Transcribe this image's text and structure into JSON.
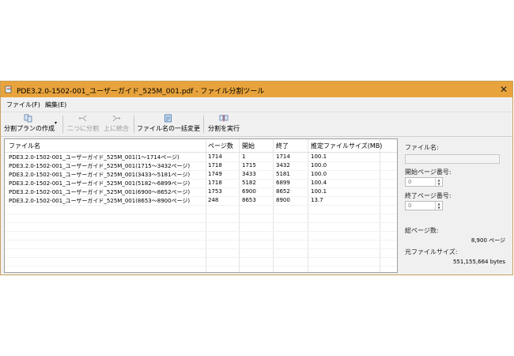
{
  "window": {
    "title": "PDE3.2.0-1502-001_ユーザーガイド_525M_001.pdf - ファイル分割ツール",
    "close_glyph": "✕"
  },
  "menu": {
    "items": [
      {
        "label": "ファイル(F)"
      },
      {
        "label": "編集(E)"
      }
    ]
  },
  "toolbar": {
    "split_plan_label": "分割プランの作成",
    "split_two_label": "二つに分割",
    "merge_up_label": "上に統合",
    "rename_all_label": "ファイル名の一括変更",
    "run_split_label": "分割を実行",
    "dropdown_glyph": "▾"
  },
  "table": {
    "headers": {
      "filename": "ファイル名",
      "pages": "ページ数",
      "start": "開始",
      "end": "終了",
      "size": "推定ファイルサイズ(MB)"
    },
    "rows": [
      {
        "filename": "PDE3.2.0-1502-001_ユーザーガイド_525M_001(1～1714ページ)",
        "pages": "1714",
        "start": "1",
        "end": "1714",
        "size": "100.1"
      },
      {
        "filename": "PDE3.2.0-1502-001_ユーザーガイド_525M_001(1715～3432ページ)",
        "pages": "1718",
        "start": "1715",
        "end": "3432",
        "size": "100.0"
      },
      {
        "filename": "PDE3.2.0-1502-001_ユーザーガイド_525M_001(3433～5181ページ)",
        "pages": "1749",
        "start": "3433",
        "end": "5181",
        "size": "100.0"
      },
      {
        "filename": "PDE3.2.0-1502-001_ユーザーガイド_525M_001(5182～6899ページ)",
        "pages": "1718",
        "start": "5182",
        "end": "6899",
        "size": "100.4"
      },
      {
        "filename": "PDE3.2.0-1502-001_ユーザーガイド_525M_001(6900～8652ページ)",
        "pages": "1753",
        "start": "6900",
        "end": "8652",
        "size": "100.1"
      },
      {
        "filename": "PDE3.2.0-1502-001_ユーザーガイド_525M_001(8653～8900ページ)",
        "pages": "248",
        "start": "8653",
        "end": "8900",
        "size": "13.7"
      }
    ]
  },
  "side": {
    "filename_label": "ファイル名:",
    "filename_value": "",
    "start_page_label": "開始ページ番号:",
    "start_page_value": "0",
    "end_page_label": "終了ページ番号:",
    "end_page_value": "0",
    "total_pages_label": "総ページ数:",
    "total_pages_value": "8,900 ページ",
    "source_size_label": "元ファイルサイズ:",
    "source_size_value": "551,155,664 bytes"
  },
  "colors": {
    "titlebar": "#e8a33c",
    "window_bg": "#f0f0f0"
  }
}
